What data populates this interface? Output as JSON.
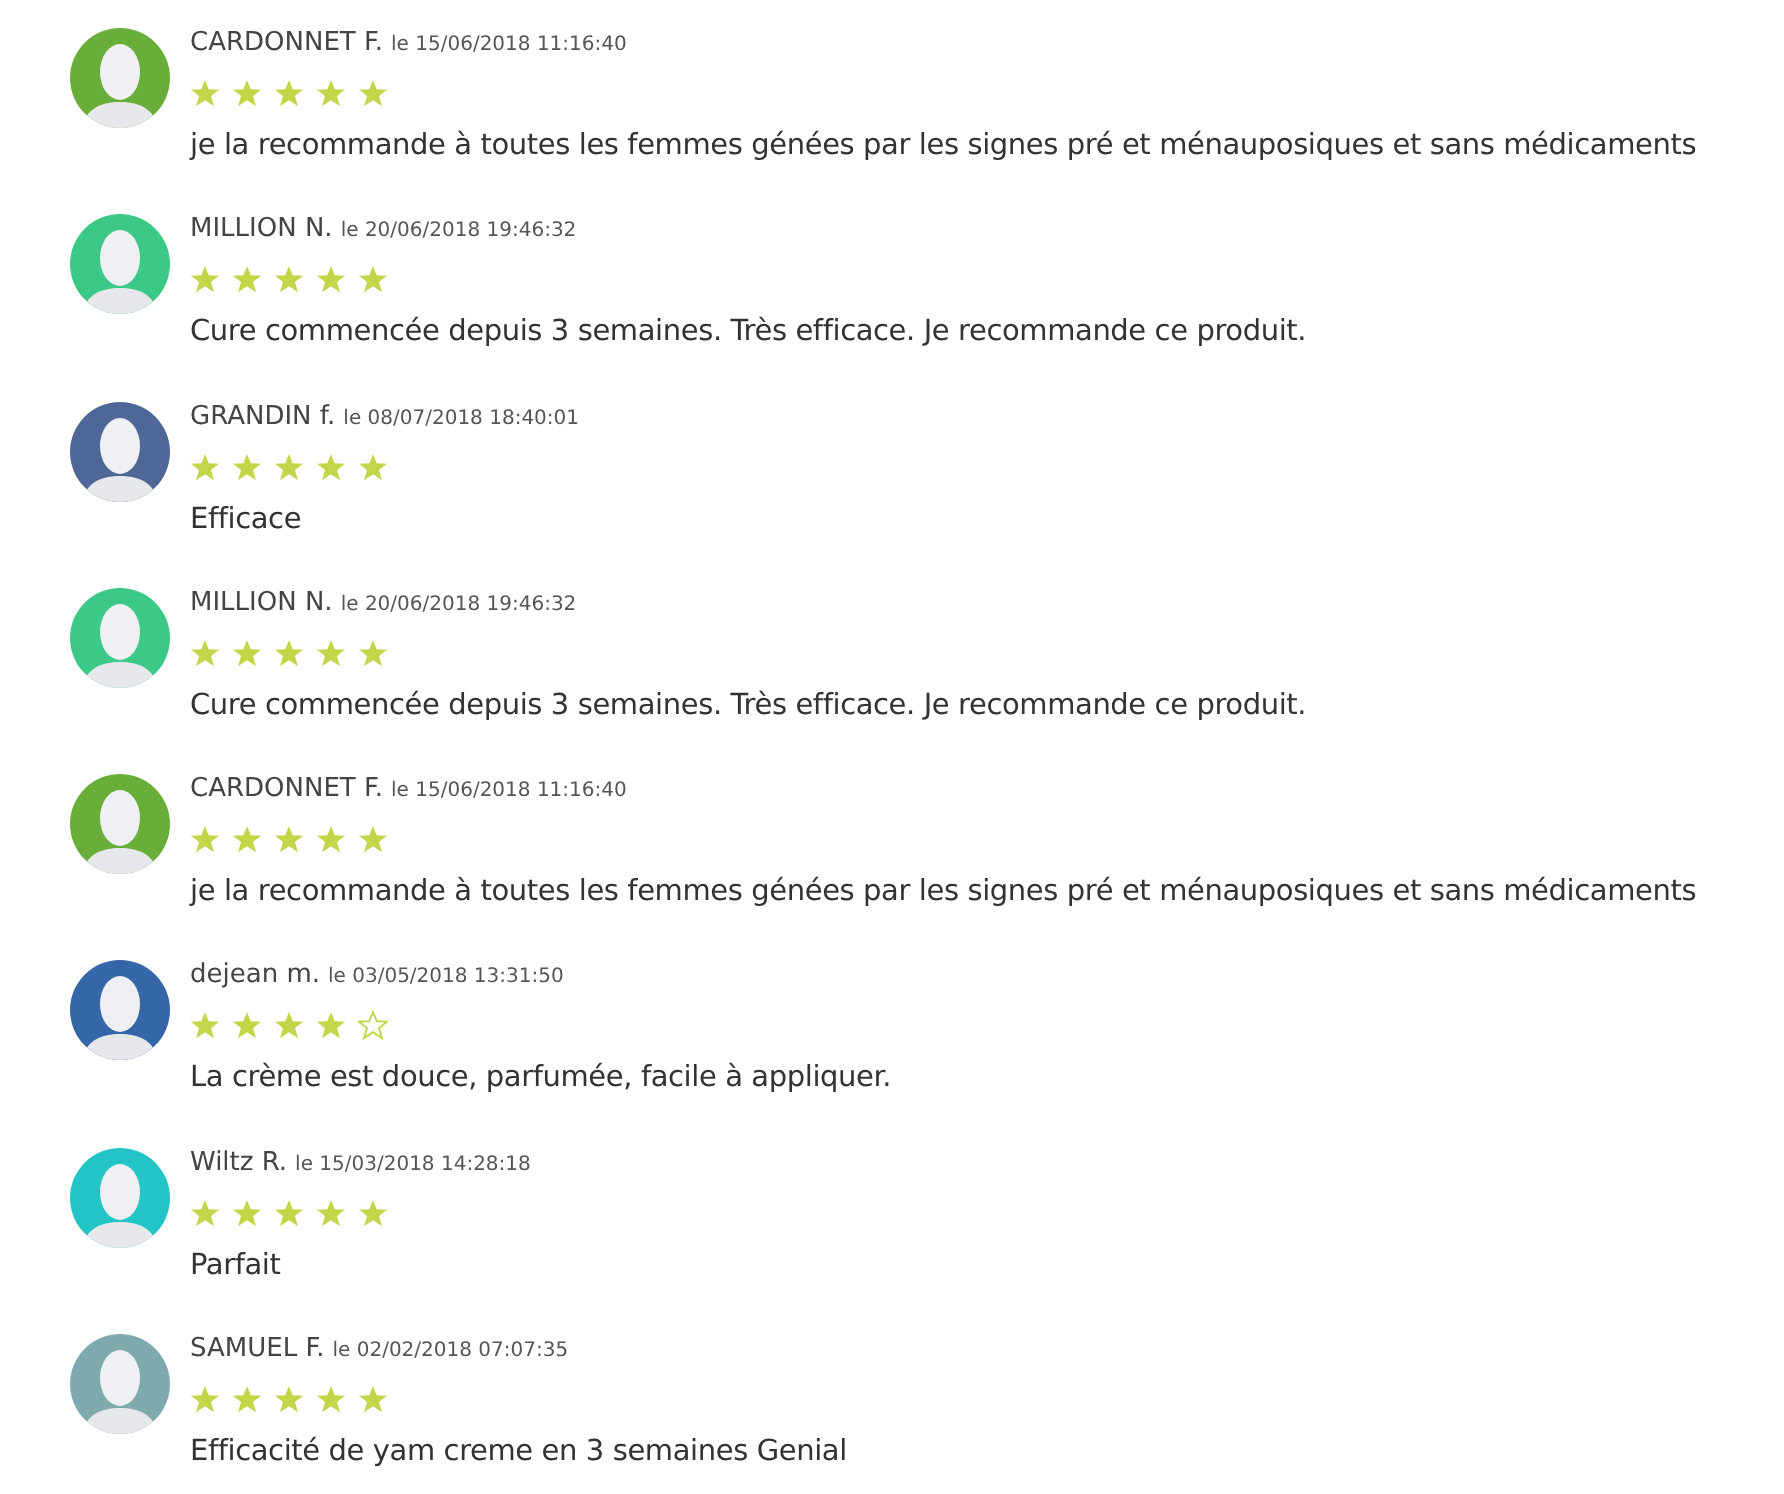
{
  "reviews": [
    {
      "author": "CARDONNET F.",
      "date": "le 15/06/2018 11:16:40",
      "stars": 5,
      "text": "je la recommande à toutes les femmes génées par les signes pré et ménauposiques et sans médicaments",
      "color": "#6aae3a"
    },
    {
      "author": "MILLION N.",
      "date": "le 20/06/2018 19:46:32",
      "stars": 5,
      "text": "Cure commencée depuis 3 semaines. Très efficace. Je recommande ce produit.",
      "color": "#3cc887"
    },
    {
      "author": "GRANDIN f.",
      "date": "le 08/07/2018 18:40:01",
      "stars": 5,
      "text": "Efficace",
      "color": "#4f6796"
    },
    {
      "author": "MILLION N.",
      "date": "le 20/06/2018 19:46:32",
      "stars": 5,
      "text": "Cure commencée depuis 3 semaines. Très efficace. Je recommande ce produit.",
      "color": "#3cc887"
    },
    {
      "author": "CARDONNET F.",
      "date": "le 15/06/2018 11:16:40",
      "stars": 5,
      "text": "je la recommande à toutes les femmes génées par les signes pré et ménauposiques et sans médicaments",
      "color": "#6aae3a"
    },
    {
      "author": "dejean m.",
      "date": "le 03/05/2018 13:31:50",
      "stars": 4,
      "text": "La crème est douce, parfumée, facile à appliquer.",
      "color": "#3566a8"
    },
    {
      "author": "Wiltz R.",
      "date": "le 15/03/2018 14:28:18",
      "stars": 5,
      "text": "Parfait",
      "color": "#22c4c6"
    },
    {
      "author": "SAMUEL F.",
      "date": "le 02/02/2018 07:07:35",
      "stars": 5,
      "text": "Efficacité de yam creme en 3 semaines Genial",
      "color": "#7faaad"
    }
  ]
}
